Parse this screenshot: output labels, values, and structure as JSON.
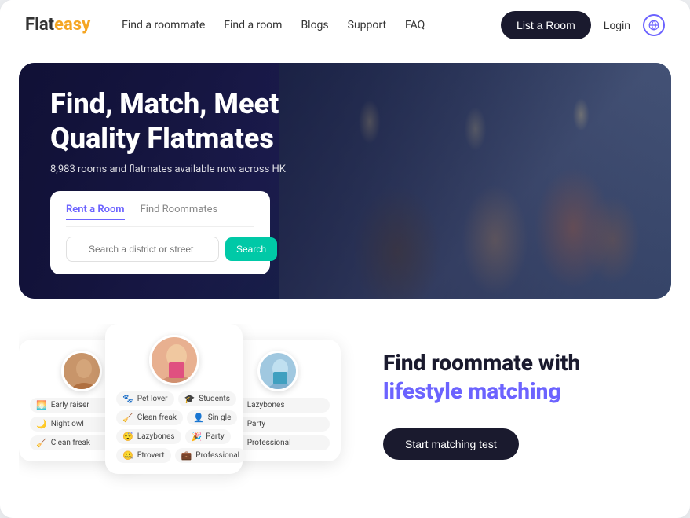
{
  "brand": {
    "flat": "Flat",
    "easy": "easy"
  },
  "navbar": {
    "links": [
      {
        "label": "Find a roommate",
        "key": "find-roommate"
      },
      {
        "label": "Find a room",
        "key": "find-room"
      },
      {
        "label": "Blogs",
        "key": "blogs"
      },
      {
        "label": "Support",
        "key": "support"
      },
      {
        "label": "FAQ",
        "key": "faq"
      }
    ],
    "list_room_btn": "List a Room",
    "login_btn": "Login",
    "globe_icon": "🌐"
  },
  "hero": {
    "title_line1": "Find, Match, Meet",
    "title_line2": "Quality Flatmates",
    "subtitle": "8,983 rooms and flatmates available now across HK",
    "search": {
      "tab_rent": "Rent a Room",
      "tab_find": "Find Roommates",
      "placeholder": "Search a district or street",
      "search_btn": "Search"
    }
  },
  "profiles": {
    "card_left": {
      "tags": [
        "Early raiser",
        "Night owl",
        "Clean freak"
      ]
    },
    "card_center": {
      "tags": [
        "Pet lover",
        "Students",
        "Clean freak",
        "Sin gle",
        "Lazybones",
        "Party",
        "Etrovert",
        "Professional"
      ]
    },
    "card_right": {
      "tags": [
        "Lazybones",
        "Party",
        "Professional"
      ]
    }
  },
  "lifestyle": {
    "title_plain": "Find roommate with",
    "title_highlight": "lifestyle matching",
    "cta_btn": "Start matching test"
  }
}
